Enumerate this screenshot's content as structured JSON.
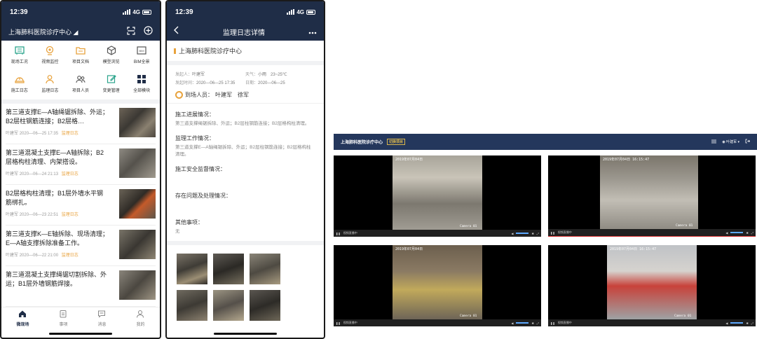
{
  "phone_home": {
    "status_time": "12:39",
    "network": "4G",
    "org_name": "上海肺科医院诊疗中心",
    "quick_menu": [
      {
        "label": "现场工况",
        "icon": "site-condition-icon",
        "color": "#2aa38b"
      },
      {
        "label": "视频监控",
        "icon": "camera-icon",
        "color": "#e8a23c"
      },
      {
        "label": "项目文档",
        "icon": "folder-icon",
        "color": "#e8a23c"
      },
      {
        "label": "模型浏览",
        "icon": "cube-icon",
        "color": "#555555"
      },
      {
        "label": "BIM全景",
        "icon": "bim-icon",
        "color": "#555555"
      },
      {
        "label": "施工日志",
        "icon": "helmet-icon",
        "color": "#e8a23c"
      },
      {
        "label": "监理日志",
        "icon": "supervisor-icon",
        "color": "#e8a23c"
      },
      {
        "label": "项目人员",
        "icon": "people-icon",
        "color": "#555555"
      },
      {
        "label": "变更管理",
        "icon": "edit-icon",
        "color": "#2aa38b"
      },
      {
        "label": "全部模块",
        "icon": "grid-icon",
        "color": "#1f2d47"
      }
    ],
    "feed": [
      {
        "title": "第三道支撑E—A轴绳锯拆除、外运；B2层柱钢筋连接；B2层格…",
        "author": "叶建军",
        "time": "2020—06—25 17:35",
        "tag": "监理日志"
      },
      {
        "title": "第三道混凝土支撑E—A轴拆除；B2层格构柱清理、内架搭设。",
        "author": "叶建军",
        "time": "2020—06—24 21:13",
        "tag": "监理日志"
      },
      {
        "title": "B2层格构柱清理；B1层外墙水平钢筋绑扎。",
        "author": "叶建军",
        "time": "2020—06—23 22:51",
        "tag": "监理日志"
      },
      {
        "title": "第三道支撑K—E轴拆除、现场清理；E—A轴支撑拆除准备工作。",
        "author": "叶建军",
        "time": "2020—06—22 21:00",
        "tag": "监理日志"
      },
      {
        "title": "第三道混凝土支撑绳锯切割拆除、外运；B1层外墙钢筋焊接。",
        "author": "",
        "time": "",
        "tag": ""
      }
    ],
    "tabs": [
      {
        "label": "微现场",
        "icon": "home-icon",
        "active": true
      },
      {
        "label": "事项",
        "icon": "task-icon",
        "active": false
      },
      {
        "label": "消息",
        "icon": "message-icon",
        "active": false
      },
      {
        "label": "我的",
        "icon": "user-icon",
        "active": false
      }
    ]
  },
  "phone_detail": {
    "status_time": "12:39",
    "network": "4G",
    "title": "监理日志详情",
    "org_name": "上海肺科医院诊疗中心",
    "initiator_label": "发起人：",
    "initiator": "叶建军",
    "weather_label": "天气：",
    "weather": "小雨　23~25℃",
    "publish_label": "发起时间：",
    "publish_time": "2020—06—25 17:35",
    "date_label": "日期：",
    "date": "2020—06—25",
    "attendees_label": "到场人员：",
    "attendees": "叶建军　徐军",
    "sections": [
      {
        "title": "施工进展情况：",
        "body": "第三道支撑绳锯拆除、外运；B2层柱钢筋连接；B2层格构柱清理。"
      },
      {
        "title": "监理工作情况：",
        "body": "第三道支撑E—A轴绳锯拆除、外运；B2层柱钢筋连接；B2层格构柱清理。"
      },
      {
        "title": "施工安全监督情况：",
        "body": ""
      },
      {
        "title": "存在问题及处理情况：",
        "body": ""
      },
      {
        "title": "其他事项：",
        "body": "无"
      }
    ]
  },
  "desktop": {
    "title": "上海肺科医院诊疗中心",
    "badge": "切换项目",
    "user": "叶建军",
    "cameras": [
      {
        "timestamp": "2019年07月04日",
        "id": "Camera 01",
        "status": "视频直播中"
      },
      {
        "timestamp": "2019年07月04日 16:15:47",
        "id": "Camera 01",
        "status": "视频直播中"
      },
      {
        "timestamp": "2019年07月04日",
        "id": "Camera 01",
        "status": "视频直播中"
      },
      {
        "timestamp": "2019年07月04日 16:15:47",
        "id": "Camera 01",
        "status": "视频直播中"
      }
    ]
  },
  "colors": {
    "navy": "#1f2d47",
    "accent": "#e8a23c",
    "desktop_header": "#24375c"
  }
}
